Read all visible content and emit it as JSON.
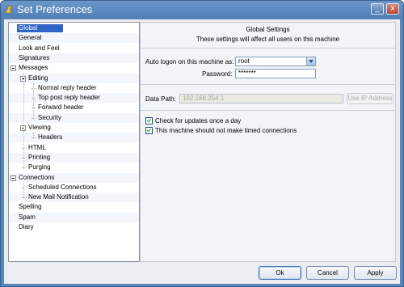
{
  "window": {
    "title": "Set Preferences",
    "minimize_label": "_",
    "close_label": "x"
  },
  "tree": {
    "items": [
      {
        "label": "Global",
        "depth": 0,
        "selected": true,
        "expandable": false
      },
      {
        "label": "General",
        "depth": 0,
        "expandable": false
      },
      {
        "label": "Look and Feel",
        "depth": 0,
        "expandable": false
      },
      {
        "label": "Signatures",
        "depth": 0,
        "expandable": false
      },
      {
        "label": "Messages",
        "depth": 0,
        "expandable": true
      },
      {
        "label": "Editing",
        "depth": 1,
        "expandable": true
      },
      {
        "label": "Normal reply header",
        "depth": 2,
        "expandable": false
      },
      {
        "label": "Top post reply header",
        "depth": 2,
        "expandable": false
      },
      {
        "label": "Forward header",
        "depth": 2,
        "expandable": false
      },
      {
        "label": "Security",
        "depth": 2,
        "expandable": false
      },
      {
        "label": "Viewing",
        "depth": 1,
        "expandable": true
      },
      {
        "label": "Headers",
        "depth": 2,
        "expandable": false
      },
      {
        "label": "HTML",
        "depth": 1,
        "expandable": false
      },
      {
        "label": "Printing",
        "depth": 1,
        "expandable": false
      },
      {
        "label": "Purging",
        "depth": 1,
        "expandable": false
      },
      {
        "label": "Connections",
        "depth": 0,
        "expandable": true
      },
      {
        "label": "Scheduled Connections",
        "depth": 1,
        "expandable": false
      },
      {
        "label": "New Mail Notification",
        "depth": 1,
        "expandable": false
      },
      {
        "label": "Spelling",
        "depth": 0,
        "expandable": false
      },
      {
        "label": "Spam",
        "depth": 0,
        "expandable": false
      },
      {
        "label": "Diary",
        "depth": 0,
        "expandable": false
      }
    ]
  },
  "panel": {
    "title": "Global Settings",
    "subtitle": "These settings will affect all users on this machine",
    "auto_logon_label": "Auto logon on this machine as:",
    "auto_logon_value": "root",
    "password_label": "Password:",
    "password_value": "*******",
    "data_path_label": "Data Path:",
    "data_path_value": "192.168.254.1",
    "use_ip_label": "Use IP Address",
    "check_updates_label": "Check for updates once a day",
    "check_updates_checked": true,
    "no_timed_label": "This machine should not make timed connections",
    "no_timed_checked": true
  },
  "buttons": {
    "ok": "Ok",
    "cancel": "Cancel",
    "apply": "Apply"
  },
  "colors": {
    "title_bar": "#5a86b9",
    "selection": "#2f63c4",
    "window_bg": "#ecedf1"
  }
}
